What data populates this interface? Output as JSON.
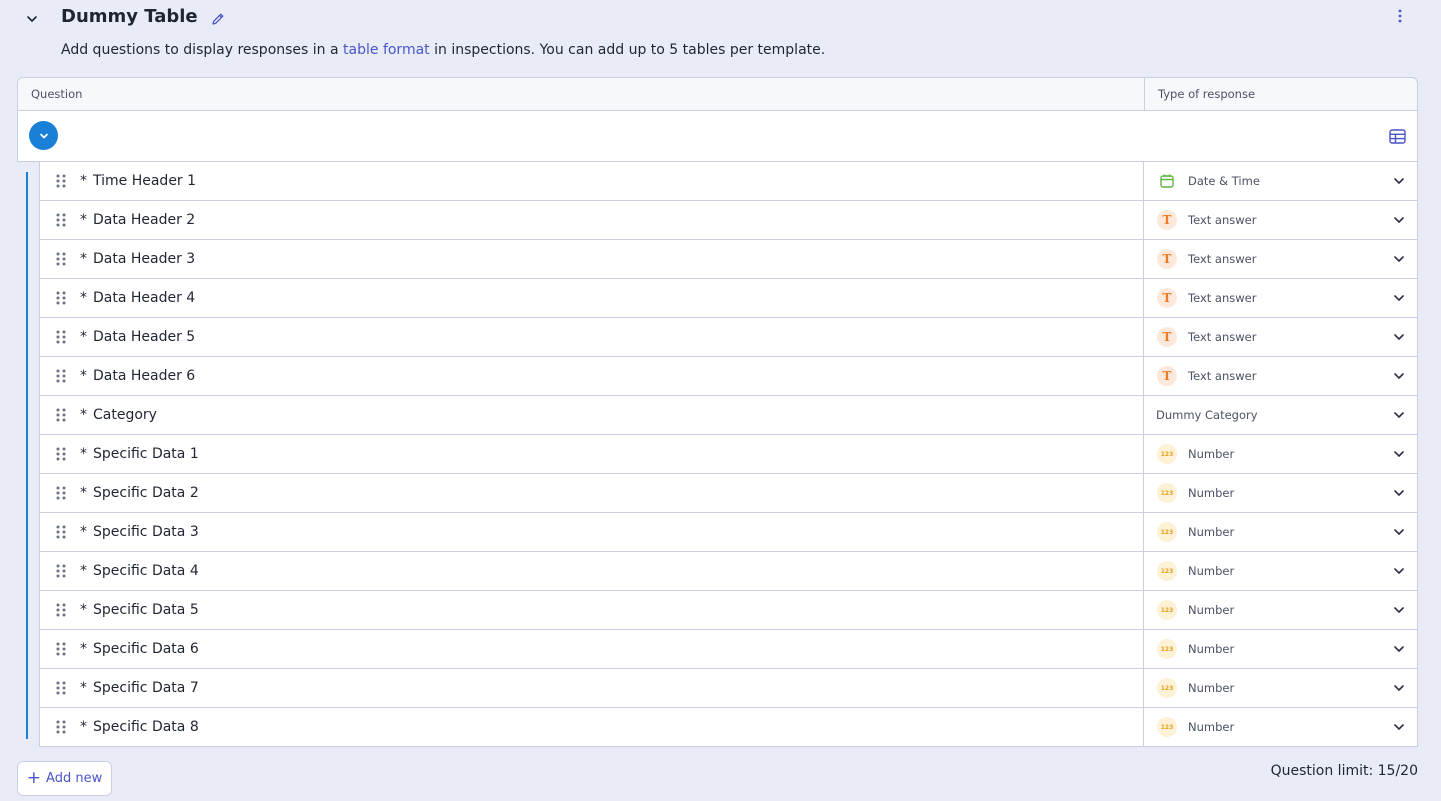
{
  "header": {
    "title": "Dummy Table",
    "collapse_icon": "chevron-down-icon",
    "edit_icon": "pencil-icon",
    "more_icon": "more-vertical-icon"
  },
  "description": {
    "before": "Add questions to display responses in a ",
    "link": "table format",
    "after": " in inspections. You can add up to 5 tables per template."
  },
  "table": {
    "col_question": "Question",
    "col_type": "Type of response",
    "rows": [
      {
        "required": "*",
        "question": "Time Header 1",
        "type": "Date & Time",
        "icon": "date"
      },
      {
        "required": "*",
        "question": "Data Header 2",
        "type": "Text answer",
        "icon": "text"
      },
      {
        "required": "*",
        "question": "Data Header 3",
        "type": "Text answer",
        "icon": "text"
      },
      {
        "required": "*",
        "question": "Data Header 4",
        "type": "Text answer",
        "icon": "text"
      },
      {
        "required": "*",
        "question": "Data Header 5",
        "type": "Text answer",
        "icon": "text"
      },
      {
        "required": "*",
        "question": "Data Header 6",
        "type": "Text answer",
        "icon": "text"
      },
      {
        "required": "*",
        "question": "Category",
        "type": "Dummy Category",
        "icon": "none"
      },
      {
        "required": "*",
        "question": "Specific Data 1",
        "type": "Number",
        "icon": "number"
      },
      {
        "required": "*",
        "question": "Specific Data 2",
        "type": "Number",
        "icon": "number"
      },
      {
        "required": "*",
        "question": "Specific Data 3",
        "type": "Number",
        "icon": "number"
      },
      {
        "required": "*",
        "question": "Specific Data 4",
        "type": "Number",
        "icon": "number"
      },
      {
        "required": "*",
        "question": "Specific Data 5",
        "type": "Number",
        "icon": "number"
      },
      {
        "required": "*",
        "question": "Specific Data 6",
        "type": "Number",
        "icon": "number"
      },
      {
        "required": "*",
        "question": "Specific Data 7",
        "type": "Number",
        "icon": "number"
      },
      {
        "required": "*",
        "question": "Specific Data 8",
        "type": "Number",
        "icon": "number"
      }
    ]
  },
  "icons": {
    "text_glyph": "T",
    "number_glyph": "123"
  },
  "footer": {
    "add_plus": "+",
    "add_label": "Add new",
    "limit": "Question limit: 15/20"
  },
  "colors": {
    "accent": "#4a55c7",
    "toggle_blue": "#1a7fd6",
    "background": "#e9ecf7"
  }
}
